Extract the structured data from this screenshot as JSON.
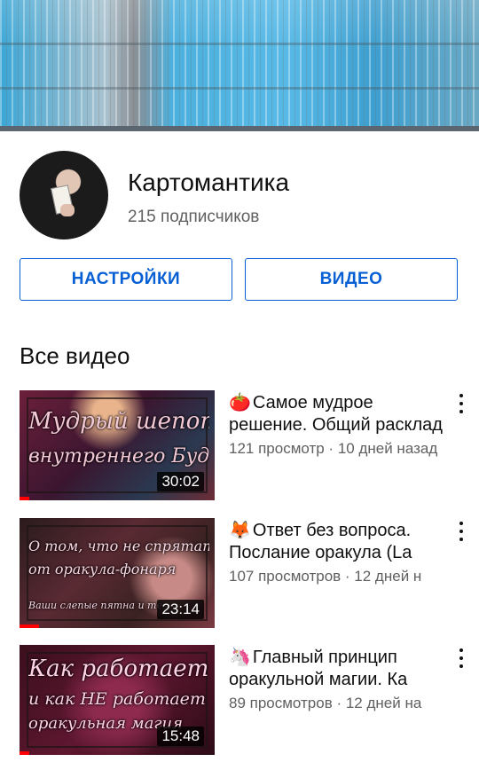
{
  "channel": {
    "name": "Картомантика",
    "subscribers": "215 подписчиков"
  },
  "buttons": {
    "settings_label": "НАСТРОЙКИ",
    "videos_label": "ВИДЕО"
  },
  "section": {
    "title": "Все видео"
  },
  "videos": [
    {
      "emoji": "🍅",
      "title": "Самое мудрое решение. Общий расклад",
      "meta": "121 просмотр · 10 дней назад",
      "duration": "30:02",
      "thumb_text": [
        "Мудрый шепот",
        "внутреннего Будды"
      ],
      "watched_fraction": 0.05
    },
    {
      "emoji": "🦊",
      "title": "Ответ без вопроса. Послание оракула (La",
      "meta": "107 просмотров · 12 дней н",
      "duration": "23:14",
      "thumb_text": [
        "О том, что не спрятать",
        "от оракула-фонаря",
        "Ваши слепые пятна и те"
      ],
      "watched_fraction": 0.1
    },
    {
      "emoji": "🦄",
      "title": "Главный принцип оракульной магии. Ка",
      "meta": "89 просмотров · 12 дней на",
      "duration": "15:48",
      "thumb_text": [
        "Как работает",
        "и как НЕ работает",
        "оракульная магия"
      ],
      "watched_fraction": 0.05
    }
  ],
  "colors": {
    "accent": "#065fd4",
    "text_primary": "#0f0f0f",
    "text_secondary": "#606060",
    "progress": "#ff0000"
  }
}
